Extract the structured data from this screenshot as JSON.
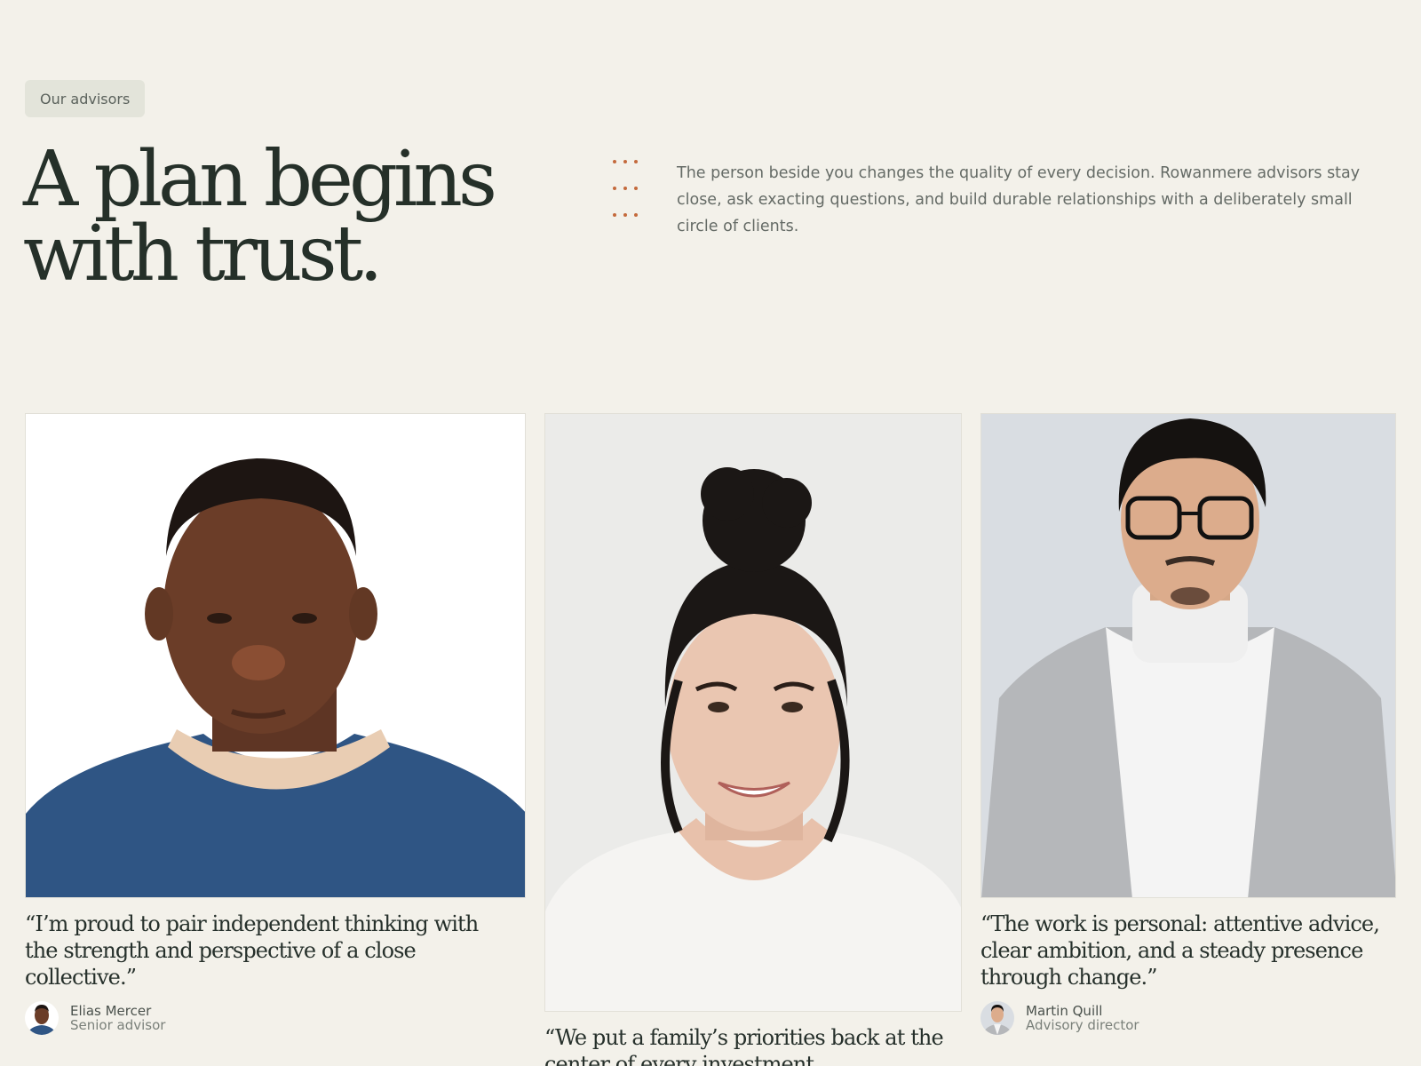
{
  "section": {
    "eyebrow": "Our advisors",
    "headline_line1": "A plan begins",
    "headline_line2": "with trust.",
    "intro": "The person beside you changes the quality of every decision. Rowanmere advisors stay close, ask exacting questions, and build durable relationships with a deliberately small circle of clients.",
    "accent_color": "#c46a3c"
  },
  "advisors": [
    {
      "quote": "“I’m proud to pair independent thinking with the strength and perspective of a close collective.”",
      "name": "Elias Mercer",
      "role": "Senior advisor"
    },
    {
      "quote": "“We put a family’s priorities back at the center of every investment conversation.”"
    },
    {
      "quote": "“The work is personal: attentive advice, clear ambition, and a steady presence through change.”",
      "name": "Martin Quill",
      "role": "Advisory director"
    }
  ]
}
